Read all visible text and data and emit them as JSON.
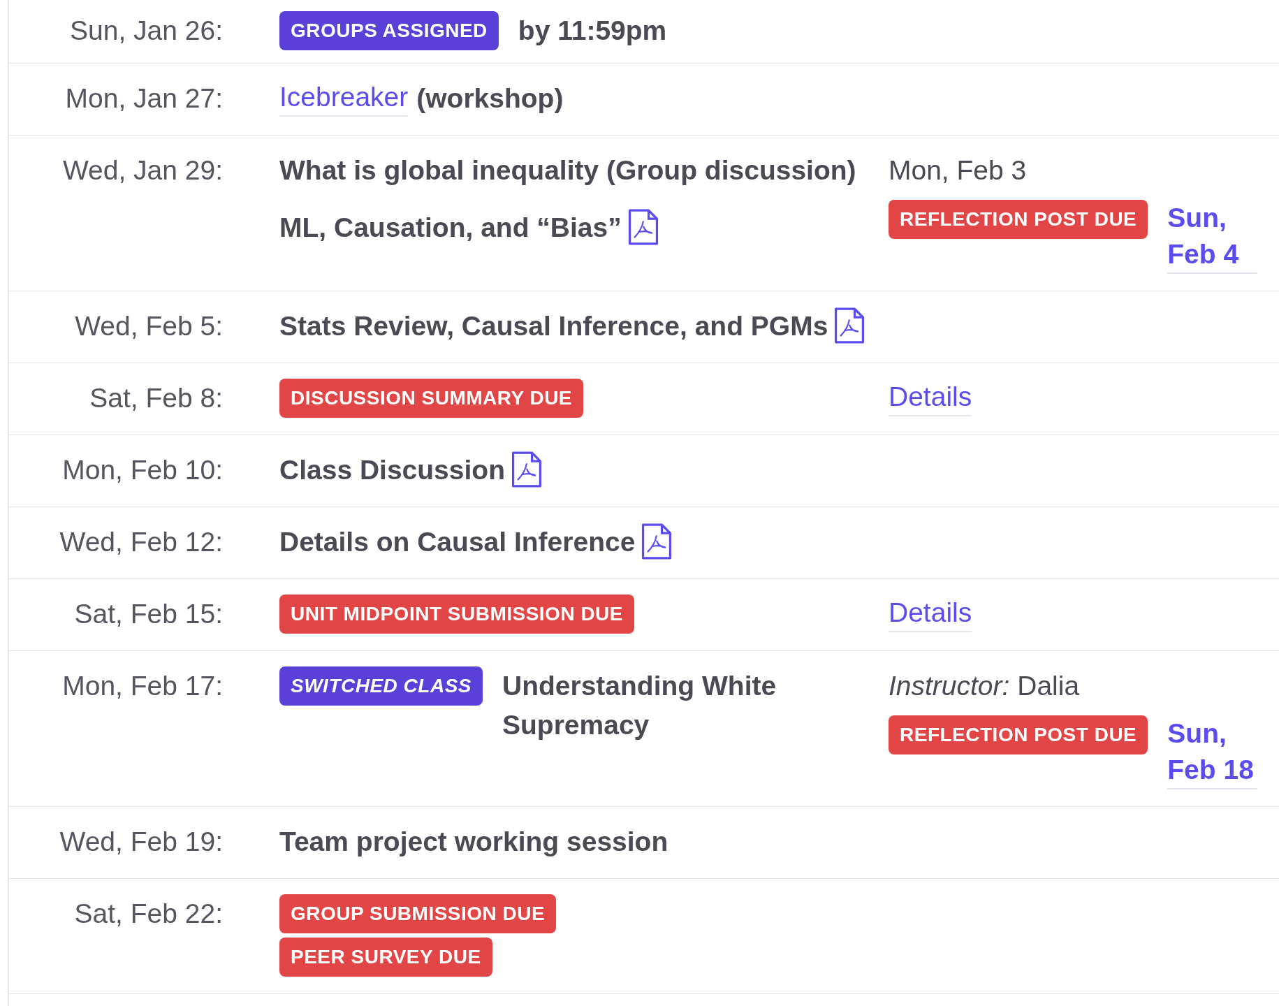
{
  "rows": [
    {
      "date": "Sun, Jan 26:",
      "main": [
        [
          {
            "kind": "badge",
            "color": "#5a3fd8",
            "italic": false,
            "text": "GROUPS ASSIGNED"
          },
          {
            "kind": "text",
            "text": "by 11:59pm"
          }
        ]
      ],
      "side": []
    },
    {
      "date": "Mon, Jan 27:",
      "main": [
        [
          {
            "kind": "link",
            "bold": false,
            "text": "Icebreaker"
          },
          {
            "kind": "text",
            "text": "(workshop)"
          }
        ]
      ],
      "side": []
    },
    {
      "date": "Wed, Jan 29:",
      "main": [
        [
          {
            "kind": "text",
            "text": "What is global inequality (Group discussion)"
          }
        ],
        [
          {
            "kind": "text",
            "text": "ML, Causation, and “Bias”"
          },
          {
            "kind": "pdf"
          }
        ]
      ],
      "side": [
        [
          {
            "kind": "plain",
            "text": "Mon, Feb 3"
          }
        ],
        [
          {
            "kind": "badge",
            "color": "#e24545",
            "italic": false,
            "text": "REFLECTION POST DUE"
          },
          {
            "kind": "link",
            "bold": true,
            "text": "Sun, Feb 4"
          }
        ]
      ]
    },
    {
      "date": "Wed, Feb 5:",
      "main": [
        [
          {
            "kind": "text",
            "text": "Stats Review, Causal Inference, and PGMs"
          },
          {
            "kind": "pdf"
          }
        ]
      ],
      "side": []
    },
    {
      "date": "Sat, Feb 8:",
      "main": [
        [
          {
            "kind": "badge",
            "color": "#e24545",
            "italic": false,
            "text": "DISCUSSION SUMMARY DUE"
          }
        ]
      ],
      "side": [
        [
          {
            "kind": "link",
            "bold": false,
            "text": "Details"
          }
        ]
      ]
    },
    {
      "date": "Mon, Feb 10:",
      "main": [
        [
          {
            "kind": "text",
            "text": "Class Discussion"
          },
          {
            "kind": "pdf"
          }
        ]
      ],
      "side": []
    },
    {
      "date": "Wed, Feb 12:",
      "main": [
        [
          {
            "kind": "text",
            "text": "Details on Causal Inference"
          },
          {
            "kind": "pdf"
          }
        ]
      ],
      "side": []
    },
    {
      "date": "Sat, Feb 15:",
      "main": [
        [
          {
            "kind": "badge",
            "color": "#e24545",
            "italic": false,
            "text": "UNIT MIDPOINT SUBMISSION DUE"
          }
        ]
      ],
      "side": [
        [
          {
            "kind": "link",
            "bold": false,
            "text": "Details"
          }
        ]
      ]
    },
    {
      "date": "Mon, Feb 17:",
      "main": [
        [
          {
            "kind": "badge",
            "color": "#5a3fd8",
            "italic": true,
            "text": "SWITCHED CLASS"
          },
          {
            "kind": "text",
            "text": "Understanding White Supremacy"
          }
        ]
      ],
      "side": [
        [
          {
            "kind": "plain",
            "text": "*Instructor:* Dalia"
          }
        ],
        [
          {
            "kind": "badge",
            "color": "#e24545",
            "italic": false,
            "text": "REFLECTION POST DUE"
          },
          {
            "kind": "link",
            "bold": true,
            "text": "Sun, Feb 18"
          }
        ]
      ]
    },
    {
      "date": "Wed, Feb 19:",
      "main": [
        [
          {
            "kind": "text",
            "text": "Team project working session"
          }
        ]
      ],
      "side": []
    },
    {
      "date": "Sat, Feb 22:",
      "main": [
        [
          {
            "kind": "badge",
            "color": "#e24545",
            "italic": false,
            "text": "GROUP SUBMISSION DUE"
          }
        ],
        [
          {
            "kind": "badge",
            "color": "#e24545",
            "italic": false,
            "text": "PEER SURVEY DUE"
          }
        ]
      ],
      "side": []
    }
  ]
}
